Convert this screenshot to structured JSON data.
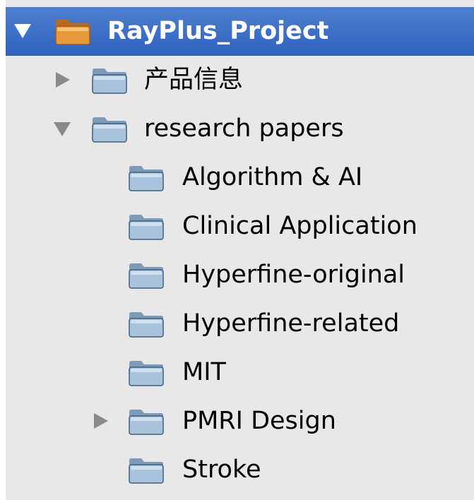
{
  "tree": {
    "root": {
      "label": "RayPlus_Project",
      "expanded": true,
      "selected": true,
      "icon": "project-folder-icon"
    },
    "items": [
      {
        "label": "产品信息",
        "level": 1,
        "expanded": false,
        "has_children": true,
        "icon": "folder-icon"
      },
      {
        "label": "research papers",
        "level": 1,
        "expanded": true,
        "has_children": true,
        "icon": "folder-icon"
      },
      {
        "label": "Algorithm & AI",
        "level": 2,
        "has_children": false,
        "icon": "folder-icon"
      },
      {
        "label": "Clinical Application",
        "level": 2,
        "has_children": false,
        "icon": "folder-icon"
      },
      {
        "label": "Hyperfine-original",
        "level": 2,
        "has_children": false,
        "icon": "folder-icon"
      },
      {
        "label": "Hyperfine-related",
        "level": 2,
        "has_children": false,
        "icon": "folder-icon"
      },
      {
        "label": "MIT",
        "level": 2,
        "has_children": false,
        "icon": "folder-icon"
      },
      {
        "label": "PMRI Design",
        "level": 2,
        "expanded": false,
        "has_children": true,
        "icon": "folder-icon"
      },
      {
        "label": "Stroke",
        "level": 2,
        "has_children": false,
        "icon": "folder-icon"
      }
    ]
  },
  "colors": {
    "selection": "#3a6cc6",
    "panel_background": "#e8e8e8",
    "folder_fill": "#a9c3dc",
    "project_folder_fill": "#e79a3a"
  }
}
